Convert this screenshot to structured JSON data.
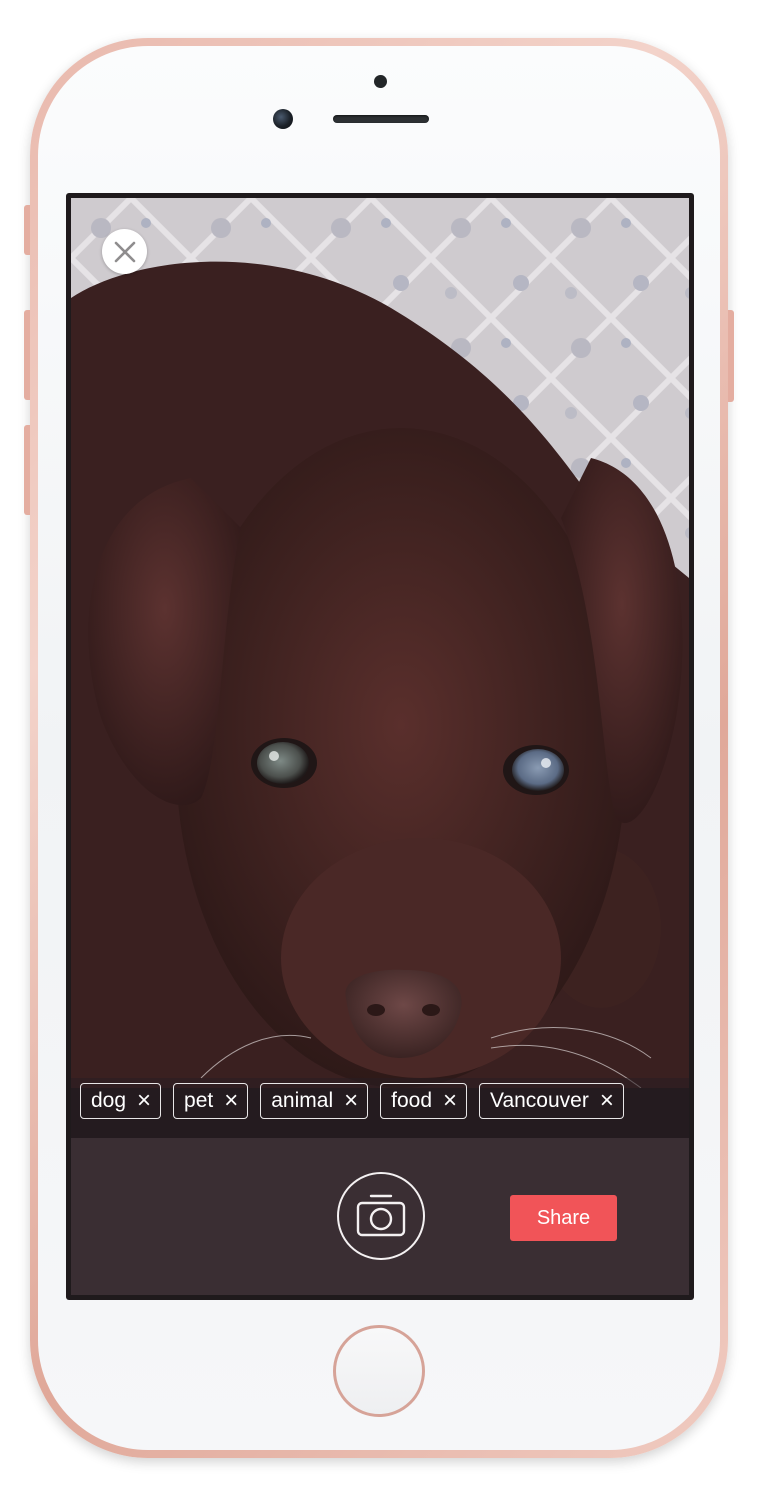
{
  "photo": {
    "subject": "chocolate labrador puppy"
  },
  "close_button": {
    "icon": "close-icon"
  },
  "tags": [
    {
      "label": "dog",
      "remove_icon": "×"
    },
    {
      "label": "pet",
      "remove_icon": "×"
    },
    {
      "label": "animal",
      "remove_icon": "×"
    },
    {
      "label": "food",
      "remove_icon": "×"
    },
    {
      "label": "Vancouver",
      "remove_icon": "×"
    }
  ],
  "controls": {
    "camera_icon": "camera-icon",
    "share_label": "Share"
  },
  "colors": {
    "share_button": "#f15458",
    "controls_bg": "#3a2e33",
    "phone_frame": "#e9b9ad"
  }
}
